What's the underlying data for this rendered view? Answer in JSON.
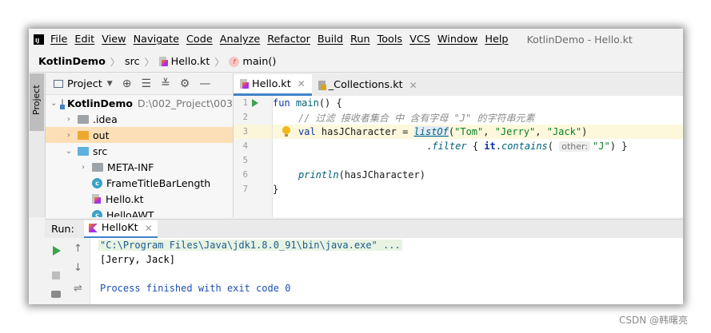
{
  "menubar": {
    "app_icon_text": "IJ",
    "items": [
      "File",
      "Edit",
      "View",
      "Navigate",
      "Code",
      "Analyze",
      "Refactor",
      "Build",
      "Run",
      "Tools",
      "VCS",
      "Window",
      "Help"
    ],
    "window_title": "KotlinDemo - Hello.kt"
  },
  "navbar": {
    "project": "KotlinDemo",
    "folder": "src",
    "file": "Hello.kt",
    "function_icon_letter": "f",
    "function": "main()"
  },
  "sidebar": {
    "tab_label": "Project"
  },
  "project_panel": {
    "title": "Project",
    "tree": [
      {
        "label": "KotlinDemo",
        "hint": "D:\\002_Project\\003",
        "chevron": "⌄",
        "icon": "module"
      },
      {
        "label": ".idea",
        "chevron": "›",
        "icon": "grey"
      },
      {
        "label": "out",
        "chevron": "›",
        "icon": "orange"
      },
      {
        "label": "src",
        "chevron": "⌄",
        "icon": "blue"
      },
      {
        "label": "META-INF",
        "chevron": "›",
        "icon": "grey"
      },
      {
        "label": "FrameTitleBarLength",
        "icon": "class",
        "icon_letter": "c"
      },
      {
        "label": "Hello.kt",
        "icon": "kotlin-file"
      },
      {
        "label": "HelloAWT",
        "icon": "class",
        "icon_letter": "c"
      }
    ]
  },
  "editor_tabs": [
    {
      "label": "Hello.kt",
      "active": true
    },
    {
      "label": "_Collections.kt",
      "active": false
    }
  ],
  "editor": {
    "line_numbers": [
      "1",
      "2",
      "3",
      "4",
      "5",
      "6",
      "7"
    ],
    "comment": "// 过滤 接收者集合 中 含有字母 \"J\" 的字符串元素",
    "kw_fun": "fun",
    "fn_main": "main",
    "main_tail": "() {",
    "kw_val": "val",
    "var_name": "hasJCharacter",
    "assign": " = ",
    "fn_listof": "listOf",
    "str_tom": "\"Tom\"",
    "str_jerry": "\"Jerry\"",
    "str_jack": "\"Jack\"",
    "filter_prefix": ".",
    "fn_filter": "filter",
    "brace_open": " { ",
    "it_kw": "it",
    "contains_prefix": ".",
    "fn_contains": "contains",
    "param_hint": "other:",
    "str_j": "\"J\"",
    "brace_close": ") }",
    "fn_println": "println",
    "println_arg": "(hasJCharacter)",
    "close_brace": "}"
  },
  "run_panel": {
    "label": "Run:",
    "tab": "HelloKt",
    "console": [
      "\"C:\\Program Files\\Java\\jdk1.8.0_91\\bin\\java.exe\" ...",
      "[Jerry, Jack]",
      "",
      "Process finished with exit code 0"
    ]
  },
  "watermark": "CSDN @韩曙亮",
  "colors": {
    "keyword": "#0e33a0",
    "string": "#097d23",
    "function": "#00627a",
    "selection": "#fcdfb6",
    "tab_underline": "#4083c9"
  }
}
